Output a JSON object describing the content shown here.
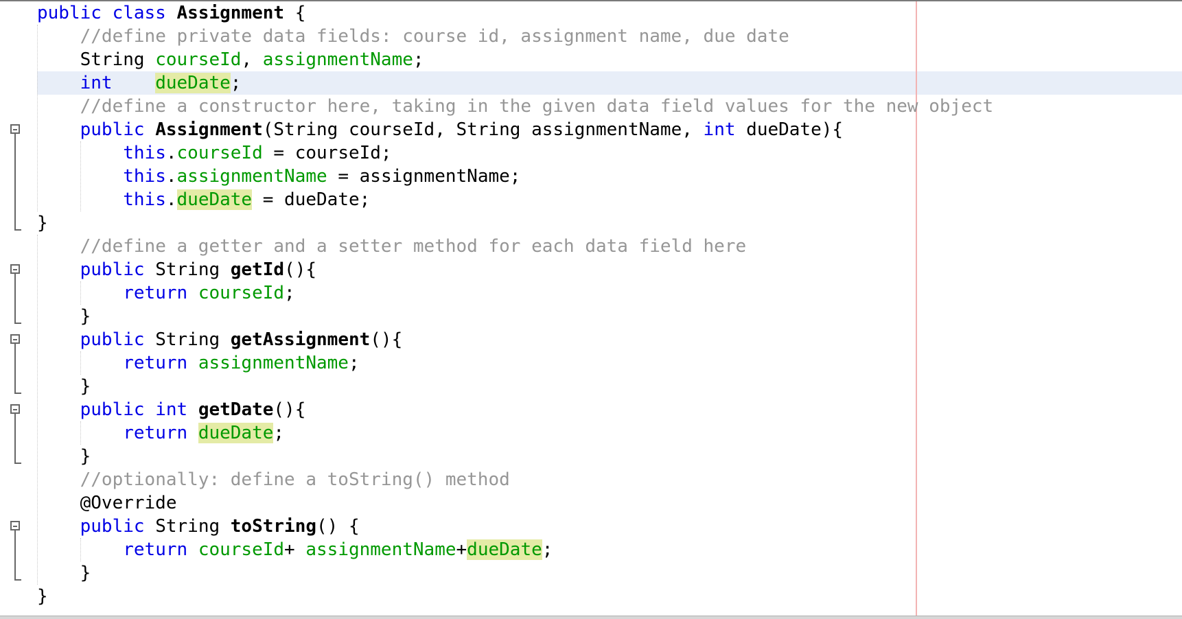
{
  "editor": {
    "lines": [
      {
        "tokens": [
          {
            "t": "public class ",
            "c": "kw"
          },
          {
            "t": "Assignment",
            "c": "fn"
          },
          {
            "t": " {",
            "c": ""
          }
        ]
      },
      {
        "tokens": [
          {
            "t": "    ",
            "c": ""
          },
          {
            "t": "//define private data fields: course id, assignment name, due date",
            "c": "cm"
          }
        ]
      },
      {
        "tokens": [
          {
            "t": "    String ",
            "c": ""
          },
          {
            "t": "courseId",
            "c": "fld"
          },
          {
            "t": ", ",
            "c": ""
          },
          {
            "t": "assignmentName",
            "c": "fld"
          },
          {
            "t": ";",
            "c": ""
          }
        ]
      },
      {
        "tokens": [
          {
            "t": "    ",
            "c": ""
          },
          {
            "t": "int",
            "c": "kw"
          },
          {
            "t": "    ",
            "c": ""
          },
          {
            "t": "dueDate",
            "c": "fld hl"
          },
          {
            "t": ";",
            "c": ""
          }
        ]
      },
      {
        "tokens": [
          {
            "t": "    ",
            "c": ""
          },
          {
            "t": "//define a constructor here, taking in the given data field values for the new object",
            "c": "cm"
          }
        ]
      },
      {
        "tokens": [
          {
            "t": "    ",
            "c": ""
          },
          {
            "t": "public",
            "c": "kw"
          },
          {
            "t": " ",
            "c": ""
          },
          {
            "t": "Assignment",
            "c": "fn"
          },
          {
            "t": "(String courseId, String assignmentName, ",
            "c": ""
          },
          {
            "t": "int",
            "c": "kw"
          },
          {
            "t": " dueDate){",
            "c": ""
          }
        ]
      },
      {
        "tokens": [
          {
            "t": "        ",
            "c": ""
          },
          {
            "t": "this",
            "c": "kw"
          },
          {
            "t": ".",
            "c": ""
          },
          {
            "t": "courseId",
            "c": "fld"
          },
          {
            "t": " = courseId;",
            "c": ""
          }
        ]
      },
      {
        "tokens": [
          {
            "t": "        ",
            "c": ""
          },
          {
            "t": "this",
            "c": "kw"
          },
          {
            "t": ".",
            "c": ""
          },
          {
            "t": "assignmentName",
            "c": "fld"
          },
          {
            "t": " = assignmentName;",
            "c": ""
          }
        ]
      },
      {
        "tokens": [
          {
            "t": "        ",
            "c": ""
          },
          {
            "t": "this",
            "c": "kw"
          },
          {
            "t": ".",
            "c": ""
          },
          {
            "t": "dueDate",
            "c": "fld hl"
          },
          {
            "t": " = dueDate;",
            "c": ""
          }
        ]
      },
      {
        "tokens": [
          {
            "t": "}",
            "c": ""
          }
        ]
      },
      {
        "tokens": [
          {
            "t": "    ",
            "c": ""
          },
          {
            "t": "//define a getter and a setter method for each data field here",
            "c": "cm"
          }
        ]
      },
      {
        "tokens": [
          {
            "t": "    ",
            "c": ""
          },
          {
            "t": "public",
            "c": "kw"
          },
          {
            "t": " String ",
            "c": ""
          },
          {
            "t": "getId",
            "c": "fn"
          },
          {
            "t": "(){",
            "c": ""
          }
        ]
      },
      {
        "tokens": [
          {
            "t": "        ",
            "c": ""
          },
          {
            "t": "return",
            "c": "kw"
          },
          {
            "t": " ",
            "c": ""
          },
          {
            "t": "courseId",
            "c": "fld"
          },
          {
            "t": ";",
            "c": ""
          }
        ]
      },
      {
        "tokens": [
          {
            "t": "    }",
            "c": ""
          }
        ]
      },
      {
        "tokens": [
          {
            "t": "    ",
            "c": ""
          },
          {
            "t": "public",
            "c": "kw"
          },
          {
            "t": " String ",
            "c": ""
          },
          {
            "t": "getAssignment",
            "c": "fn"
          },
          {
            "t": "(){",
            "c": ""
          }
        ]
      },
      {
        "tokens": [
          {
            "t": "        ",
            "c": ""
          },
          {
            "t": "return",
            "c": "kw"
          },
          {
            "t": " ",
            "c": ""
          },
          {
            "t": "assignmentName",
            "c": "fld"
          },
          {
            "t": ";",
            "c": ""
          }
        ]
      },
      {
        "tokens": [
          {
            "t": "    }",
            "c": ""
          }
        ]
      },
      {
        "tokens": [
          {
            "t": "    ",
            "c": ""
          },
          {
            "t": "public",
            "c": "kw"
          },
          {
            "t": " ",
            "c": ""
          },
          {
            "t": "int",
            "c": "kw"
          },
          {
            "t": " ",
            "c": ""
          },
          {
            "t": "getDate",
            "c": "fn"
          },
          {
            "t": "(){",
            "c": ""
          }
        ]
      },
      {
        "tokens": [
          {
            "t": "        ",
            "c": ""
          },
          {
            "t": "return",
            "c": "kw"
          },
          {
            "t": " ",
            "c": ""
          },
          {
            "t": "dueDate",
            "c": "fld hl"
          },
          {
            "t": ";",
            "c": ""
          }
        ]
      },
      {
        "tokens": [
          {
            "t": "    }",
            "c": ""
          }
        ]
      },
      {
        "tokens": [
          {
            "t": "    ",
            "c": ""
          },
          {
            "t": "//optionally: define a toString() method",
            "c": "cm"
          }
        ]
      },
      {
        "tokens": [
          {
            "t": "    @Override",
            "c": ""
          }
        ]
      },
      {
        "tokens": [
          {
            "t": "    ",
            "c": ""
          },
          {
            "t": "public",
            "c": "kw"
          },
          {
            "t": " String ",
            "c": ""
          },
          {
            "t": "toString",
            "c": "fn"
          },
          {
            "t": "() {",
            "c": ""
          }
        ]
      },
      {
        "tokens": [
          {
            "t": "        ",
            "c": ""
          },
          {
            "t": "return",
            "c": "kw"
          },
          {
            "t": " ",
            "c": ""
          },
          {
            "t": "courseId",
            "c": "fld"
          },
          {
            "t": "+ ",
            "c": ""
          },
          {
            "t": "assignmentName",
            "c": "fld"
          },
          {
            "t": "+",
            "c": ""
          },
          {
            "t": "dueDate",
            "c": "fld hl"
          },
          {
            "t": ";",
            "c": ""
          }
        ]
      },
      {
        "tokens": [
          {
            "t": "    }",
            "c": ""
          }
        ]
      },
      {
        "tokens": [
          {
            "t": "}",
            "c": ""
          }
        ]
      }
    ],
    "current_line_index": 3,
    "fold_markers": [
      {
        "line_index": 5,
        "end_index": 9,
        "icon": "fold-collapse-icon"
      },
      {
        "line_index": 11,
        "end_index": 13,
        "icon": "fold-collapse-icon"
      },
      {
        "line_index": 14,
        "end_index": 16,
        "icon": "fold-collapse-icon"
      },
      {
        "line_index": 17,
        "end_index": 19,
        "icon": "fold-collapse-icon"
      },
      {
        "line_index": 22,
        "end_index": 24,
        "icon": "fold-collapse-icon"
      }
    ],
    "colors": {
      "keyword": "#0000e6",
      "comment": "#969696",
      "field": "#009900",
      "highlight": "#e4eba6",
      "current_line": "#e8eef8",
      "margin_line": "#f2b3b3"
    }
  }
}
